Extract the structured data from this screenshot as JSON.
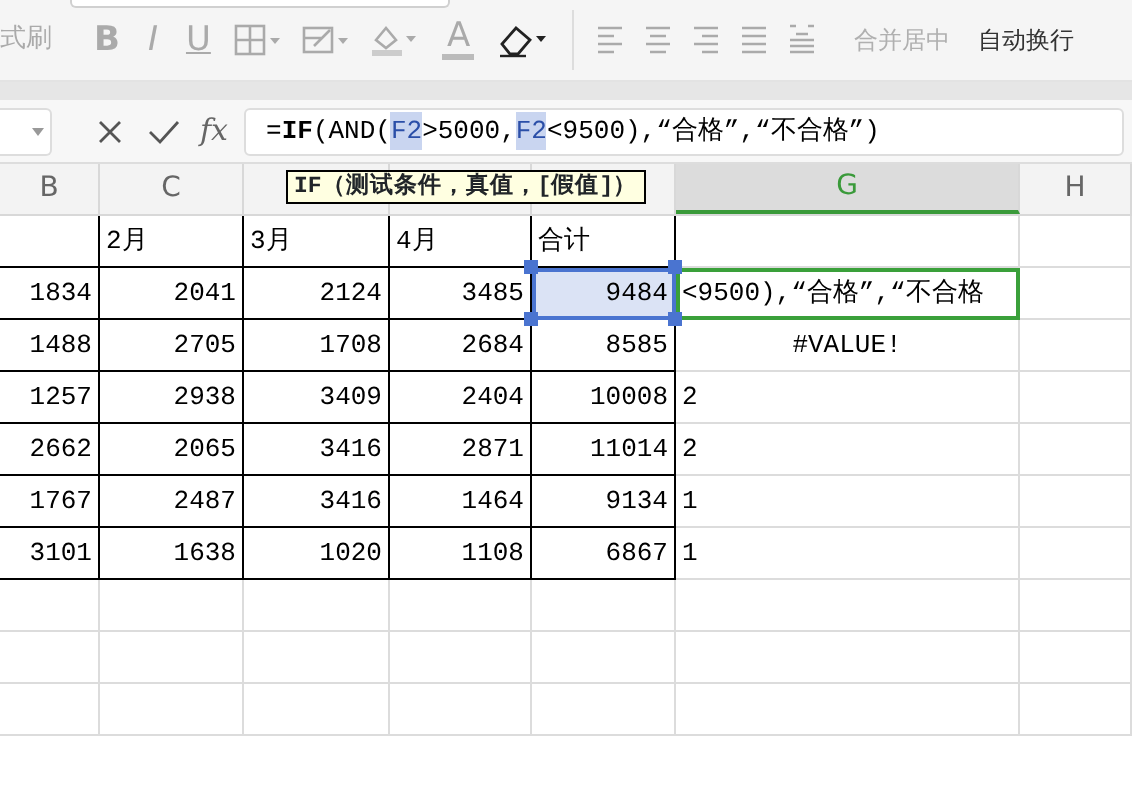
{
  "ribbon": {
    "left_fragment": "式刷",
    "format_glyphs": [
      "B",
      "I",
      "U"
    ],
    "font_color_glyph": "A",
    "merge_button": {
      "label": "合并居中",
      "disabled": true
    },
    "wrap_button": {
      "label": "自动换行",
      "disabled": false
    }
  },
  "formula_bar": {
    "fx": "fx",
    "segments": [
      {
        "text": "=**IF**(AND(",
        "ref": false
      },
      {
        "text": "F2",
        "ref": true
      },
      {
        "text": ">5000,",
        "ref": false
      },
      {
        "text": "F2",
        "ref": true
      },
      {
        "text": "<9500),“合格”,“不合格”)",
        "ref": false
      }
    ]
  },
  "tooltip": "IF（测试条件，真值，[假值]）",
  "column_headers": [
    {
      "label": "B",
      "selected": false
    },
    {
      "label": "C",
      "selected": false
    },
    {
      "selected": false
    },
    {
      "selected": false
    },
    {
      "selected": false
    },
    {
      "label": "G",
      "selected": true
    },
    {
      "label": "H",
      "selected": false
    }
  ],
  "header_row": [
    "2月",
    "3月",
    "4月",
    "合计"
  ],
  "rows": [
    {
      "values": [
        "1834",
        "2041",
        "2124",
        "3485"
      ],
      "total": "9484",
      "total_selected": true,
      "result": "<9500),“合格”,“不合格",
      "editing": true
    },
    {
      "values": [
        "1488",
        "2705",
        "1708",
        "2684"
      ],
      "total": "8585",
      "total_selected": false,
      "result": "#VALUE!",
      "editing": false
    },
    {
      "values": [
        "1257",
        "2938",
        "3409",
        "2404"
      ],
      "total": "10008",
      "total_selected": false,
      "result": "2",
      "editing": false
    },
    {
      "values": [
        "2662",
        "2065",
        "3416",
        "2871"
      ],
      "total": "11014",
      "total_selected": false,
      "result": "2",
      "editing": false
    },
    {
      "values": [
        "1767",
        "2487",
        "3416",
        "1464"
      ],
      "total": "9134",
      "total_selected": false,
      "result": "1",
      "editing": false
    },
    {
      "values": [
        "3101",
        "1638",
        "1020",
        "1108"
      ],
      "total": "6867",
      "total_selected": false,
      "result": "1",
      "editing": false
    }
  ]
}
